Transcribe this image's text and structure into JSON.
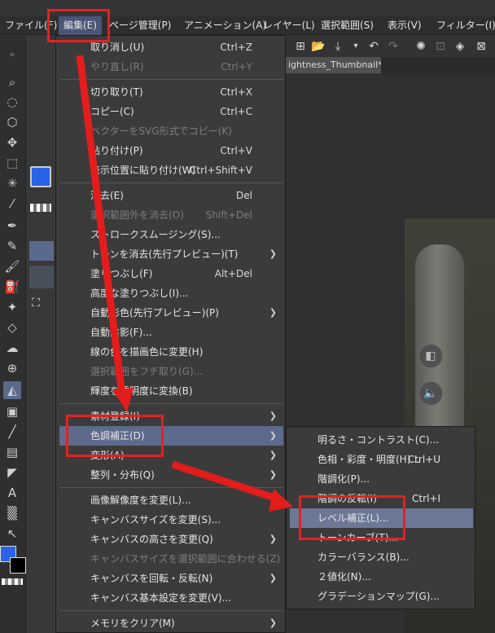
{
  "menubar": {
    "items": [
      {
        "id": "file",
        "label": "ファイル(F)"
      },
      {
        "id": "edit",
        "label": "編集(E)"
      },
      {
        "id": "page",
        "label": "ページ管理(P)"
      },
      {
        "id": "animation",
        "label": "アニメーション(A)"
      },
      {
        "id": "layer",
        "label": "レイヤー(L)"
      },
      {
        "id": "selection",
        "label": "選択範囲(S)"
      },
      {
        "id": "view",
        "label": "表示(V)"
      },
      {
        "id": "filter",
        "label": "フィルター(I)"
      }
    ]
  },
  "document_tab": {
    "title": "ightness_Thumbnail*",
    "close": "●"
  },
  "edit_menu": [
    {
      "label": "取り消し(U)",
      "shortcut": "Ctrl+Z"
    },
    {
      "label": "やり直し(R)",
      "shortcut": "Ctrl+Y",
      "disabled": true
    },
    {
      "sep": true
    },
    {
      "label": "切り取り(T)",
      "shortcut": "Ctrl+X"
    },
    {
      "label": "コピー(C)",
      "shortcut": "Ctrl+C"
    },
    {
      "label": "ベクターをSVG形式でコピー(K)",
      "shortcut": "",
      "disabled": true
    },
    {
      "label": "貼り付け(P)",
      "shortcut": "Ctrl+V"
    },
    {
      "label": "表示位置に貼り付け(W)",
      "shortcut": "Ctrl+Shift+V"
    },
    {
      "sep": true
    },
    {
      "label": "消去(E)",
      "shortcut": "Del"
    },
    {
      "label": "選択範囲外を消去(O)",
      "shortcut": "Shift+Del",
      "disabled": true
    },
    {
      "label": "ストロークスムージング(S)...",
      "shortcut": ""
    },
    {
      "label": "トーンを消去(先行プレビュー)(T)",
      "shortcut": "",
      "submenu": true
    },
    {
      "label": "塗りつぶし(F)",
      "shortcut": "Alt+Del"
    },
    {
      "label": "高度な塗りつぶし(I)...",
      "shortcut": ""
    },
    {
      "label": "自動彩色(先行プレビュー)(P)",
      "shortcut": "",
      "submenu": true
    },
    {
      "label": "自動陰影(F)...",
      "shortcut": ""
    },
    {
      "label": "線の色を描画色に変更(H)",
      "shortcut": ""
    },
    {
      "label": "選択範囲をフチ取り(G)...",
      "shortcut": "",
      "disabled": true
    },
    {
      "label": "輝度を透明度に変換(B)",
      "shortcut": ""
    },
    {
      "sep": true
    },
    {
      "label": "素材登録(I)",
      "shortcut": "",
      "submenu": true
    },
    {
      "label": "色調補正(D)",
      "shortcut": "",
      "submenu": true,
      "highlighted": true
    },
    {
      "label": "変形(A)",
      "shortcut": "",
      "submenu": true
    },
    {
      "label": "整列・分布(Q)",
      "shortcut": "",
      "submenu": true
    },
    {
      "sep": true
    },
    {
      "label": "画像解像度を変更(L)...",
      "shortcut": ""
    },
    {
      "label": "キャンバスサイズを変更(S)...",
      "shortcut": ""
    },
    {
      "label": "キャンバスの高さを変更(Q)",
      "shortcut": "",
      "submenu": true
    },
    {
      "label": "キャンバスサイズを選択範囲に合わせる(Z)",
      "shortcut": "",
      "disabled": true
    },
    {
      "label": "キャンバスを回転・反転(N)",
      "shortcut": "",
      "submenu": true
    },
    {
      "label": "キャンバス基本設定を変更(V)...",
      "shortcut": ""
    },
    {
      "sep": true
    },
    {
      "label": "メモリをクリア(M)",
      "shortcut": "",
      "submenu": true
    }
  ],
  "tone_submenu": [
    {
      "label": "明るさ・コントラスト(C)...",
      "shortcut": ""
    },
    {
      "label": "色相・彩度・明度(H)...",
      "shortcut": "Ctrl+U"
    },
    {
      "label": "階調化(P)...",
      "shortcut": ""
    },
    {
      "label": "階調の反転(I)",
      "shortcut": "Ctrl+I"
    },
    {
      "label": "レベル補正(L)...",
      "shortcut": "",
      "highlighted": true
    },
    {
      "label": "トーンカーブ(T)...",
      "shortcut": ""
    },
    {
      "label": "カラーバランス(B)...",
      "shortcut": ""
    },
    {
      "label": "２値化(N)...",
      "shortcut": ""
    },
    {
      "label": "グラデーションマップ(G)...",
      "shortcut": ""
    }
  ],
  "colors": {
    "menu_bg": "#3b3b3b",
    "highlight": "#5d6a8c",
    "annotation_red": "#e31c1c",
    "main_color": "#2a63e8"
  },
  "tools": [
    "zoom-icon",
    "lasso-icon",
    "object-select-icon",
    "move-icon",
    "marquee-icon",
    "magic-wand-icon",
    "eyedropper-icon",
    "pen-icon",
    "pencil-icon",
    "brush-icon",
    "airbrush-icon",
    "decorate-icon",
    "eraser-icon",
    "blend-icon",
    "fill-icon",
    "gradient-icon",
    "figure-icon",
    "frame-icon",
    "ruler-icon",
    "text-icon",
    "balloon-icon",
    "correction-icon"
  ]
}
